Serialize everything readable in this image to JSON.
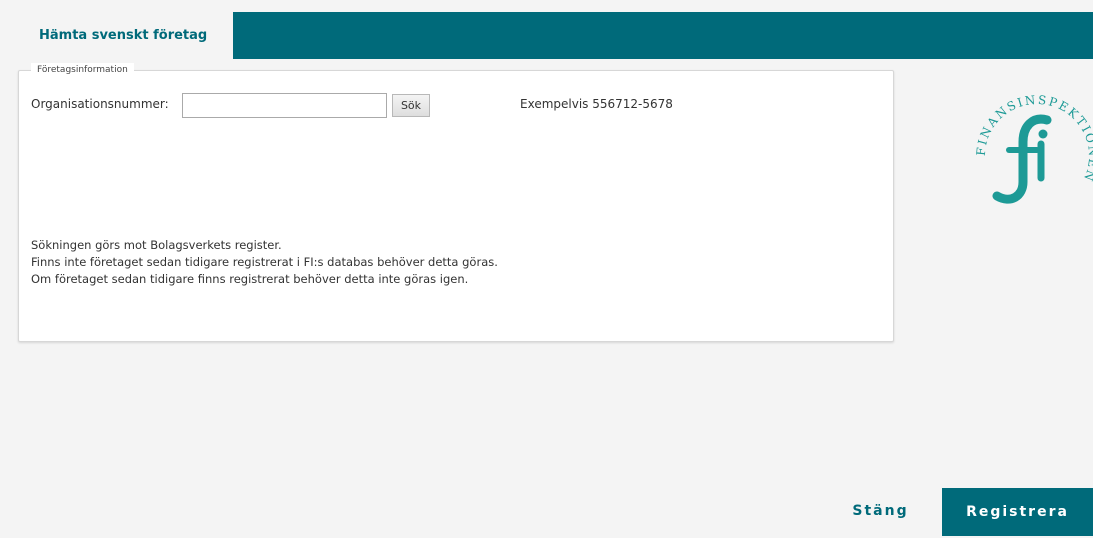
{
  "header": {
    "tab_label": "Hämta svenskt företag"
  },
  "form": {
    "legend": "Företagsinformation",
    "org_label": "Organisationsnummer:",
    "org_value": "",
    "org_placeholder": "",
    "search_button": "Sök",
    "example_text": "Exempelvis 556712-5678",
    "info_lines": [
      "Sökningen görs mot Bolagsverkets register.",
      "Finns inte företaget sedan tidigare registrerat i FI:s databas behöver detta göras.",
      "Om företaget sedan tidigare finns registrerat behöver detta inte göras igen."
    ]
  },
  "logo": {
    "icon": "finansinspektionen-logo",
    "text": "FINANSINSPEKTIONEN",
    "monogram": "fi",
    "color": "#1d9a96"
  },
  "footer": {
    "close_label": "Stäng",
    "register_label": "Registrera"
  },
  "colors": {
    "primary": "#006a7a",
    "background": "#f4f4f4"
  }
}
